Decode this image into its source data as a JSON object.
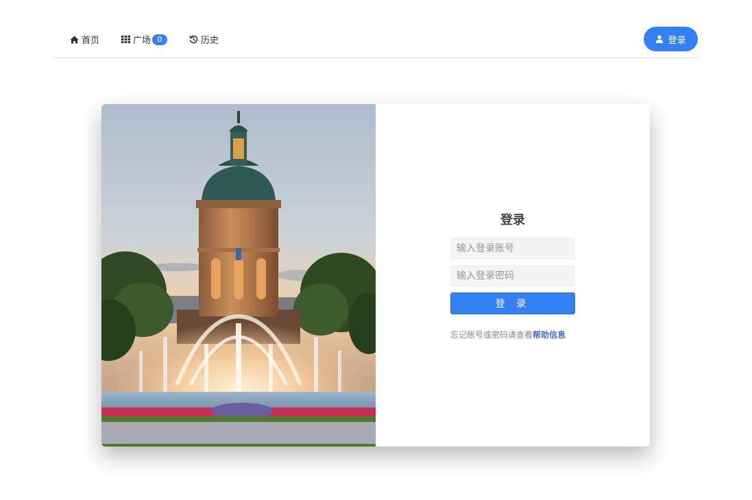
{
  "nav": {
    "items": [
      {
        "label": "首页",
        "icon": "home-icon"
      },
      {
        "label": "广场",
        "icon": "grid-icon",
        "badge": "0"
      },
      {
        "label": "历史",
        "icon": "history-icon"
      }
    ],
    "login_button": "登录"
  },
  "login": {
    "title": "登录",
    "account_placeholder": "输入登录账号",
    "password_placeholder": "输入登录密码",
    "submit": "登 录",
    "help_text": "忘记账号或密码请查看",
    "help_link": "帮助信息"
  },
  "colors": {
    "accent": "#3480f5",
    "link": "#4a6fd6"
  }
}
